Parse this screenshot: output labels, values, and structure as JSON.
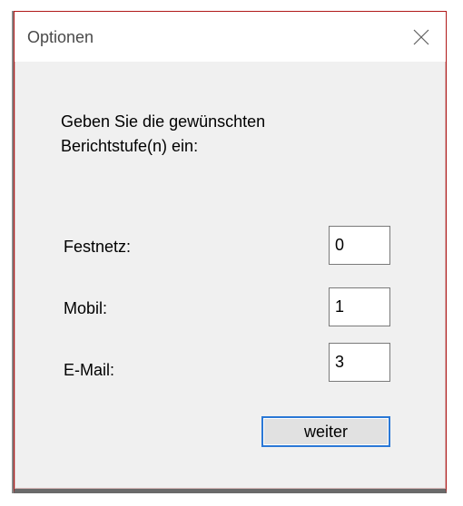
{
  "window": {
    "title": "Optionen",
    "close_icon": "close-icon"
  },
  "prompt": {
    "line1": "Geben Sie die gewünschten",
    "line2": "Berichtstufe(n) ein:"
  },
  "fields": [
    {
      "label": "Festnetz:",
      "value": "0"
    },
    {
      "label": "Mobil:",
      "value": "1"
    },
    {
      "label": "E-Mail:",
      "value": "3"
    }
  ],
  "buttons": {
    "continue_label": "weiter"
  },
  "colors": {
    "dialog_background": "#f0f0f0",
    "titlebar_background": "#ffffff",
    "window_border": "#b01818",
    "button_focus_border": "#2a78d6"
  }
}
